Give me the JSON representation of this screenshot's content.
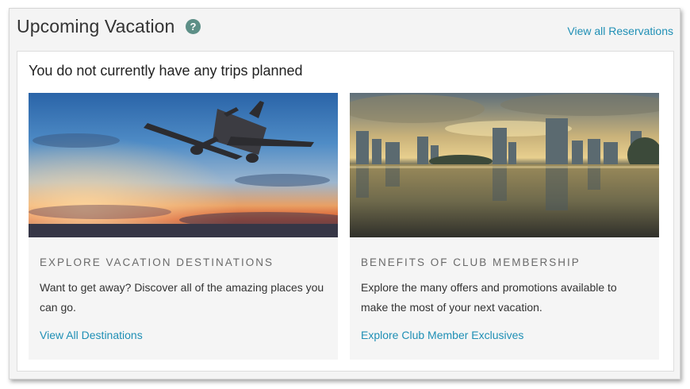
{
  "header": {
    "title": "Upcoming Vacation",
    "help_icon_glyph": "?",
    "view_all_label": "View all Reservations"
  },
  "main": {
    "empty_message": "You do not currently have any trips planned",
    "cards": [
      {
        "image": "airplane-sunset-photo",
        "heading": "EXPLORE VACATION DESTINATIONS",
        "description": "Want to get away? Discover all of the amazing places you can go.",
        "link": "View All Destinations"
      },
      {
        "image": "city-skyline-lake-photo",
        "heading": "BENEFITS OF CLUB MEMBERSHIP",
        "description": "Explore the many offers and promotions available to make the most of your next vacation.",
        "link": "Explore Club Member Exclusives"
      }
    ]
  },
  "colors": {
    "link": "#1f8fb5",
    "help_icon": "#5d8f87",
    "panel_bg": "#f4f4f4"
  }
}
